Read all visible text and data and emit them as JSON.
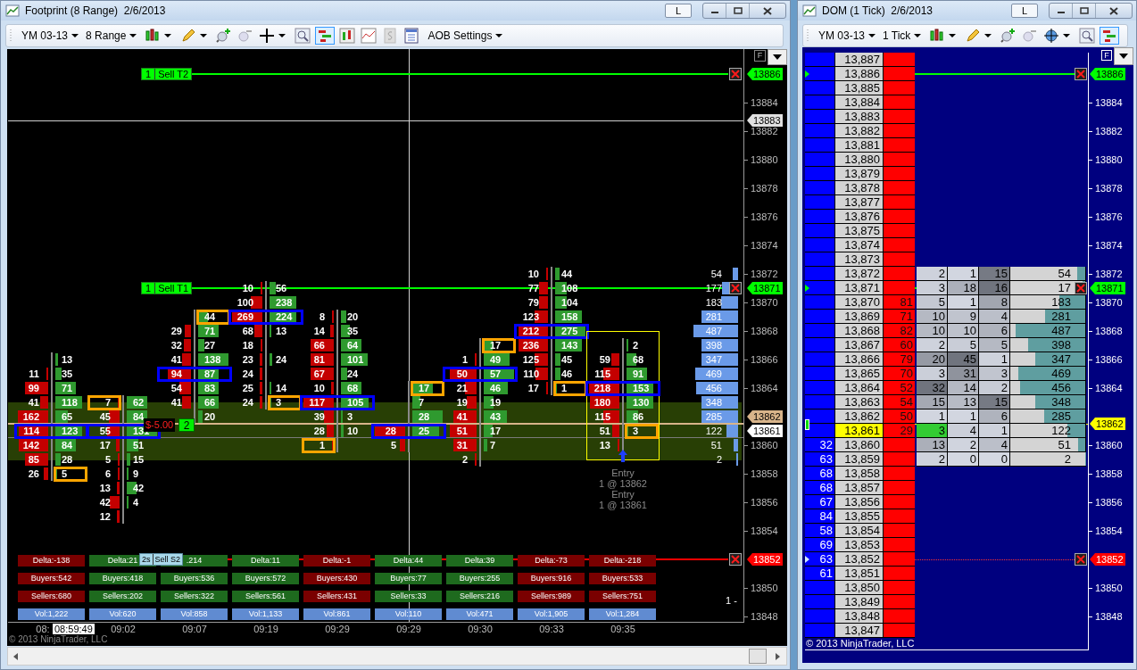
{
  "footprint_window": {
    "title": "Footprint (8 Range)  2/6/2013",
    "title_buttons": [
      "L"
    ],
    "toolbar": {
      "instrument": "YM 03-13",
      "interval": "8 Range",
      "settings_menu": "AOB Settings"
    },
    "chart": {
      "corner_button": "F",
      "y_axis": [
        "13884",
        "13882",
        "13880",
        "13878",
        "13876",
        "13874",
        "13872",
        "13870",
        "13868",
        "13866",
        "13864",
        "13860",
        "13858",
        "13856",
        "13854",
        "13850",
        "13848"
      ],
      "bars": [
        {
          "rows": [
            {},
            {},
            {},
            {},
            {},
            {},
            {
              "ask": "13"
            },
            {
              "bid": "11",
              "ask": "35"
            },
            {
              "bid": "99",
              "ask": "71"
            },
            {
              "bid": "41",
              "ask": "118"
            },
            {
              "bid": "162",
              "ask": "65"
            },
            {
              "bid": "114",
              "ask": "123",
              "max": true
            },
            {
              "bid": "142",
              "ask": "84"
            },
            {
              "bid": "85",
              "ask": "28"
            },
            {
              "bid": "26",
              "ask": "5",
              "min": true
            }
          ]
        },
        {
          "rows": [
            {},
            {},
            {},
            {},
            {},
            {},
            {},
            {},
            {},
            {
              "bid": "7",
              "ask": "62",
              "min": true
            },
            {
              "bid": "45",
              "ask": "84"
            },
            {
              "bid": "55",
              "ask": "131",
              "max": true
            },
            {
              "bid": "17",
              "ask": "51"
            },
            {
              "bid": "5",
              "ask": "15"
            },
            {
              "bid": "6",
              "ask": "9"
            },
            {
              "bid": "13",
              "ask": "42"
            },
            {
              "bid": "42",
              "ask": "4"
            },
            {
              "bid": "12"
            }
          ]
        },
        {
          "rows": [
            {},
            {},
            {},
            {
              "ask": "44",
              "min": true
            },
            {
              "bid": "29",
              "ask": "71"
            },
            {
              "bid": "32",
              "ask": "27"
            },
            {
              "bid": "41",
              "ask": "138"
            },
            {
              "bid": "94",
              "ask": "87",
              "max": true
            },
            {
              "bid": "54",
              "ask": "83"
            },
            {
              "bid": "41",
              "ask": "66"
            },
            {
              "ask": "20"
            }
          ]
        },
        {
          "rows": [
            {},
            {
              "bid": "10",
              "ask": "56"
            },
            {
              "bid": "100",
              "ask": "238"
            },
            {
              "bid": "269",
              "ask": "224",
              "max": true
            },
            {
              "bid": "68",
              "ask": "13"
            },
            {
              "bid": "18"
            },
            {
              "bid": "23",
              "ask": "24"
            },
            {
              "bid": "24"
            },
            {
              "bid": "25",
              "ask": "14"
            },
            {
              "bid": "24",
              "ask": "3",
              "min": true
            }
          ]
        },
        {
          "rows": [
            {},
            {},
            {},
            {
              "bid": "8",
              "ask": "20"
            },
            {
              "bid": "14",
              "ask": "35"
            },
            {
              "bid": "66",
              "ask": "64"
            },
            {
              "bid": "81",
              "ask": "101"
            },
            {
              "bid": "67",
              "ask": "24"
            },
            {
              "bid": "10",
              "ask": "68"
            },
            {
              "bid": "117",
              "ask": "105",
              "max": true
            },
            {
              "bid": "39",
              "ask": "3"
            },
            {
              "bid": "28",
              "ask": "10"
            },
            {
              "bid": "1",
              "min": true
            }
          ]
        },
        {
          "rows": [
            {},
            {},
            {},
            {},
            {},
            {},
            {},
            {},
            {
              "ask": "17",
              "min": true
            },
            {
              "ask": "7"
            },
            {
              "ask": "28"
            },
            {
              "bid": "28",
              "ask": "25",
              "max": true
            },
            {
              "bid": "5"
            }
          ]
        },
        {
          "rows": [
            {},
            {},
            {},
            {},
            {},
            {
              "ask": "17",
              "min": true
            },
            {
              "bid": "1",
              "ask": "49"
            },
            {
              "bid": "50",
              "ask": "57",
              "max": true
            },
            {
              "bid": "21",
              "ask": "46"
            },
            {
              "bid": "19",
              "ask": "19"
            },
            {
              "bid": "41",
              "ask": "43"
            },
            {
              "bid": "51",
              "ask": "17"
            },
            {
              "bid": "31",
              "ask": "7"
            },
            {
              "bid": "2"
            }
          ]
        },
        {
          "rows": [
            {
              "bid": "10",
              "ask": "44"
            },
            {
              "bid": "77",
              "ask": "108"
            },
            {
              "bid": "79",
              "ask": "104"
            },
            {
              "bid": "123",
              "ask": "158"
            },
            {
              "bid": "212",
              "ask": "275",
              "max": true
            },
            {
              "bid": "236",
              "ask": "143"
            },
            {
              "bid": "125",
              "ask": "45"
            },
            {
              "bid": "110",
              "ask": "46"
            },
            {
              "bid": "17",
              "ask": "1",
              "min": true
            }
          ]
        },
        {
          "selected": true,
          "rows": [
            {},
            {},
            {},
            {},
            {},
            {
              "ask": "2"
            },
            {
              "bid": "59",
              "ask": "68"
            },
            {
              "bid": "115",
              "ask": "91"
            },
            {
              "bid": "218",
              "ask": "153",
              "max": true
            },
            {
              "bid": "180",
              "ask": "130"
            },
            {
              "bid": "115",
              "ask": "86"
            },
            {
              "bid": "51",
              "ask": "3",
              "min": true
            },
            {
              "bid": "13"
            }
          ]
        }
      ],
      "volume_profile": [
        "54",
        "177",
        "183",
        "281",
        "487",
        "398",
        "347",
        "469",
        "456",
        "348",
        "285",
        "122",
        "51",
        "2"
      ],
      "stats": [
        {
          "buy": false,
          "delta": "Delta:-138",
          "buyers": "Buyers:542",
          "sellers": "Sellers:680",
          "volume": "Vol:1,222"
        },
        {
          "buy": true,
          "delta": "Delta:21",
          "buyers": "Buyers:418",
          "sellers": "Sellers:202",
          "volume": "Vol:620"
        },
        {
          "buy": true,
          "delta": ".214",
          "buyers": "Buyers:536",
          "sellers": "Sellers:322",
          "volume": "Vol:858"
        },
        {
          "buy": true,
          "delta": "Delta:11",
          "buyers": "Buyers:572",
          "sellers": "Sellers:561",
          "volume": "Vol:1,133"
        },
        {
          "buy": false,
          "delta": "Delta:-1",
          "buyers": "Buyers:430",
          "sellers": "Sellers:431",
          "volume": "Vol:861"
        },
        {
          "buy": true,
          "delta": "Delta:44",
          "buyers": "Buyers:77",
          "sellers": "Sellers:33",
          "volume": "Vol:110"
        },
        {
          "buy": true,
          "delta": "Delta:39",
          "buyers": "Buyers:255",
          "sellers": "Sellers:216",
          "volume": "Vol:471"
        },
        {
          "buy": false,
          "delta": "Delta:-73",
          "buyers": "Buyers:916",
          "sellers": "Sellers:989",
          "volume": "Vol:1,905"
        },
        {
          "buy": false,
          "delta": "Delta:-218",
          "buyers": "Buyers:533",
          "sellers": "Sellers:751",
          "volume": "Vol:1,284"
        }
      ],
      "times": [
        "08:",
        "09:02",
        "09:07",
        "09:19",
        "09:29",
        "09:29",
        "09:30",
        "09:33",
        "09:35"
      ],
      "cursor_time": "08:59:49",
      "order_lines": [
        {
          "kind": "target",
          "qty": "1",
          "label": "Sell T2",
          "tag": "13886"
        },
        {
          "kind": "target",
          "qty": "1",
          "label": "Sell T1",
          "tag": "13871"
        },
        {
          "kind": "stop",
          "qty": "2s",
          "label": "Sell S2",
          "tag": "13852"
        }
      ],
      "price_tags": [
        {
          "kind": "cursor",
          "text": "13883"
        },
        {
          "kind": "entry",
          "text": "13862"
        },
        {
          "kind": "last",
          "text": "13861"
        }
      ],
      "position": {
        "pnl": "$-5.00",
        "qty": "2"
      },
      "entries": [
        {
          "label": "Entry",
          "fill": "1 @ 13862"
        },
        {
          "label": "Entry",
          "fill": "1 @ 13861"
        }
      ],
      "note": "1 -",
      "copyright": "© 2013 NinjaTrader, LLC"
    }
  },
  "dom_window": {
    "title": "DOM (1 Tick)  2/6/2013",
    "title_buttons": [
      "L"
    ],
    "toolbar": {
      "instrument": "YM 03-13",
      "interval": "1 Tick"
    },
    "corner_button": "F",
    "ladder": [
      {
        "price": "13,887",
        "current": false
      },
      {
        "price": "13,886",
        "current": false
      },
      {
        "price": "13,885",
        "current": false
      },
      {
        "price": "13,884",
        "current": false
      },
      {
        "price": "13,883",
        "current": false
      },
      {
        "price": "13,882",
        "current": false
      },
      {
        "price": "13,881",
        "current": false
      },
      {
        "price": "13,880",
        "current": false
      },
      {
        "price": "13,879",
        "current": false
      },
      {
        "price": "13,878",
        "current": false
      },
      {
        "price": "13,877",
        "current": false
      },
      {
        "price": "13,876",
        "current": false
      },
      {
        "price": "13,875",
        "current": false
      },
      {
        "price": "13,874",
        "current": false
      },
      {
        "price": "13,873",
        "current": false
      },
      {
        "price": "13,872",
        "current": false,
        "volume": [
          "2",
          "1",
          "15",
          "54"
        ],
        "traded": false
      },
      {
        "price": "13,871",
        "current": false,
        "volume": [
          "3",
          "18",
          "16",
          "17"
        ],
        "traded": false
      },
      {
        "price": "13,870",
        "ask": "81",
        "current": false,
        "volume": [
          "5",
          "1",
          "8",
          "183"
        ],
        "traded": false
      },
      {
        "price": "13,869",
        "ask": "71",
        "current": false,
        "volume": [
          "10",
          "9",
          "4",
          "281"
        ],
        "traded": false
      },
      {
        "price": "13,868",
        "ask": "82",
        "current": false,
        "volume": [
          "10",
          "10",
          "6",
          "487"
        ],
        "traded": false
      },
      {
        "price": "13,867",
        "ask": "60",
        "current": false,
        "volume": [
          "2",
          "5",
          "5",
          "398"
        ],
        "traded": false
      },
      {
        "price": "13,866",
        "ask": "79",
        "current": false,
        "volume": [
          "20",
          "45",
          "1",
          "347"
        ],
        "traded": false
      },
      {
        "price": "13,865",
        "ask": "70",
        "current": false,
        "volume": [
          "3",
          "31",
          "3",
          "469"
        ],
        "traded": false
      },
      {
        "price": "13,864",
        "ask": "52",
        "current": false,
        "volume": [
          "32",
          "14",
          "2",
          "456"
        ],
        "traded": false
      },
      {
        "price": "13,863",
        "ask": "54",
        "current": false,
        "volume": [
          "15",
          "13",
          "15",
          "348"
        ],
        "traded": false
      },
      {
        "price": "13,862",
        "ask": "50",
        "current": false,
        "volume": [
          "1",
          "1",
          "6",
          "285"
        ],
        "traded": false
      },
      {
        "price": "13,861",
        "ask": "29",
        "current": true,
        "volume": [
          "3",
          "4",
          "1",
          "122"
        ],
        "traded": true
      },
      {
        "bid": "32",
        "price": "13,860",
        "current": false,
        "volume": [
          "13",
          "2",
          "4",
          "51"
        ],
        "traded": false
      },
      {
        "bid": "63",
        "price": "13,859",
        "current": false,
        "volume": [
          "2",
          "0",
          "0",
          "2"
        ],
        "traded": false
      },
      {
        "bid": "68",
        "price": "13,858",
        "current": false
      },
      {
        "bid": "68",
        "price": "13,857",
        "current": false
      },
      {
        "bid": "67",
        "price": "13,856",
        "current": false
      },
      {
        "bid": "84",
        "price": "13,855",
        "current": false
      },
      {
        "bid": "58",
        "price": "13,854",
        "current": false
      },
      {
        "bid": "69",
        "price": "13,853",
        "current": false
      },
      {
        "bid": "63",
        "price": "13,852",
        "current": false
      },
      {
        "bid": "61",
        "price": "13,851",
        "current": false
      },
      {
        "price": "13,850",
        "current": false
      },
      {
        "price": "13,849",
        "current": false
      },
      {
        "price": "13,848",
        "current": false
      },
      {
        "price": "13,847",
        "current": false
      }
    ],
    "y_axis": [
      "13884",
      "13882",
      "13880",
      "13878",
      "13876",
      "13874",
      "13872",
      "13870",
      "13868",
      "13866",
      "13864",
      "13860",
      "13858",
      "13856",
      "13854",
      "13850",
      "13848"
    ],
    "lines": [
      {
        "kind": "target",
        "tag": "13886"
      },
      {
        "kind": "target",
        "tag": "13871"
      },
      {
        "kind": "last",
        "tag": "13862"
      },
      {
        "kind": "stop",
        "tag": "13852"
      }
    ],
    "copyright": "© 2013 NinjaTrader, LLC"
  }
}
